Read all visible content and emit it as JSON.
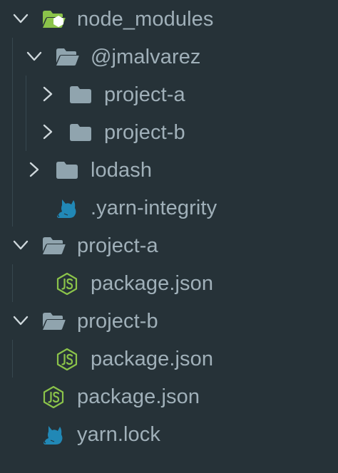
{
  "theme": {
    "background": "#263238",
    "text": "#a0b0b9",
    "chevron": "#cfd8dc",
    "folder": "#90a4ae",
    "node_modules_folder": "#8bc34a",
    "node_modules_badge": "#ffffff",
    "js_icon": "#8bc34a",
    "yarn_icon": "#2188b6",
    "guide": "#37474f"
  },
  "explorer": {
    "items": [
      {
        "label": "node_modules",
        "icon": "node-modules-folder-open-icon",
        "expanded": true
      },
      {
        "label": "@jmalvarez",
        "icon": "folder-open-icon",
        "expanded": true
      },
      {
        "label": "project-a",
        "icon": "folder-icon",
        "expanded": false
      },
      {
        "label": "project-b",
        "icon": "folder-icon",
        "expanded": false
      },
      {
        "label": "lodash",
        "icon": "folder-icon",
        "expanded": false
      },
      {
        "label": ".yarn-integrity",
        "icon": "yarn-icon"
      },
      {
        "label": "project-a",
        "icon": "folder-open-icon",
        "expanded": true
      },
      {
        "label": "package.json",
        "icon": "nodejs-icon"
      },
      {
        "label": "project-b",
        "icon": "folder-open-icon",
        "expanded": true
      },
      {
        "label": "package.json",
        "icon": "nodejs-icon"
      },
      {
        "label": "package.json",
        "icon": "nodejs-icon"
      },
      {
        "label": "yarn.lock",
        "icon": "yarn-icon"
      }
    ]
  }
}
